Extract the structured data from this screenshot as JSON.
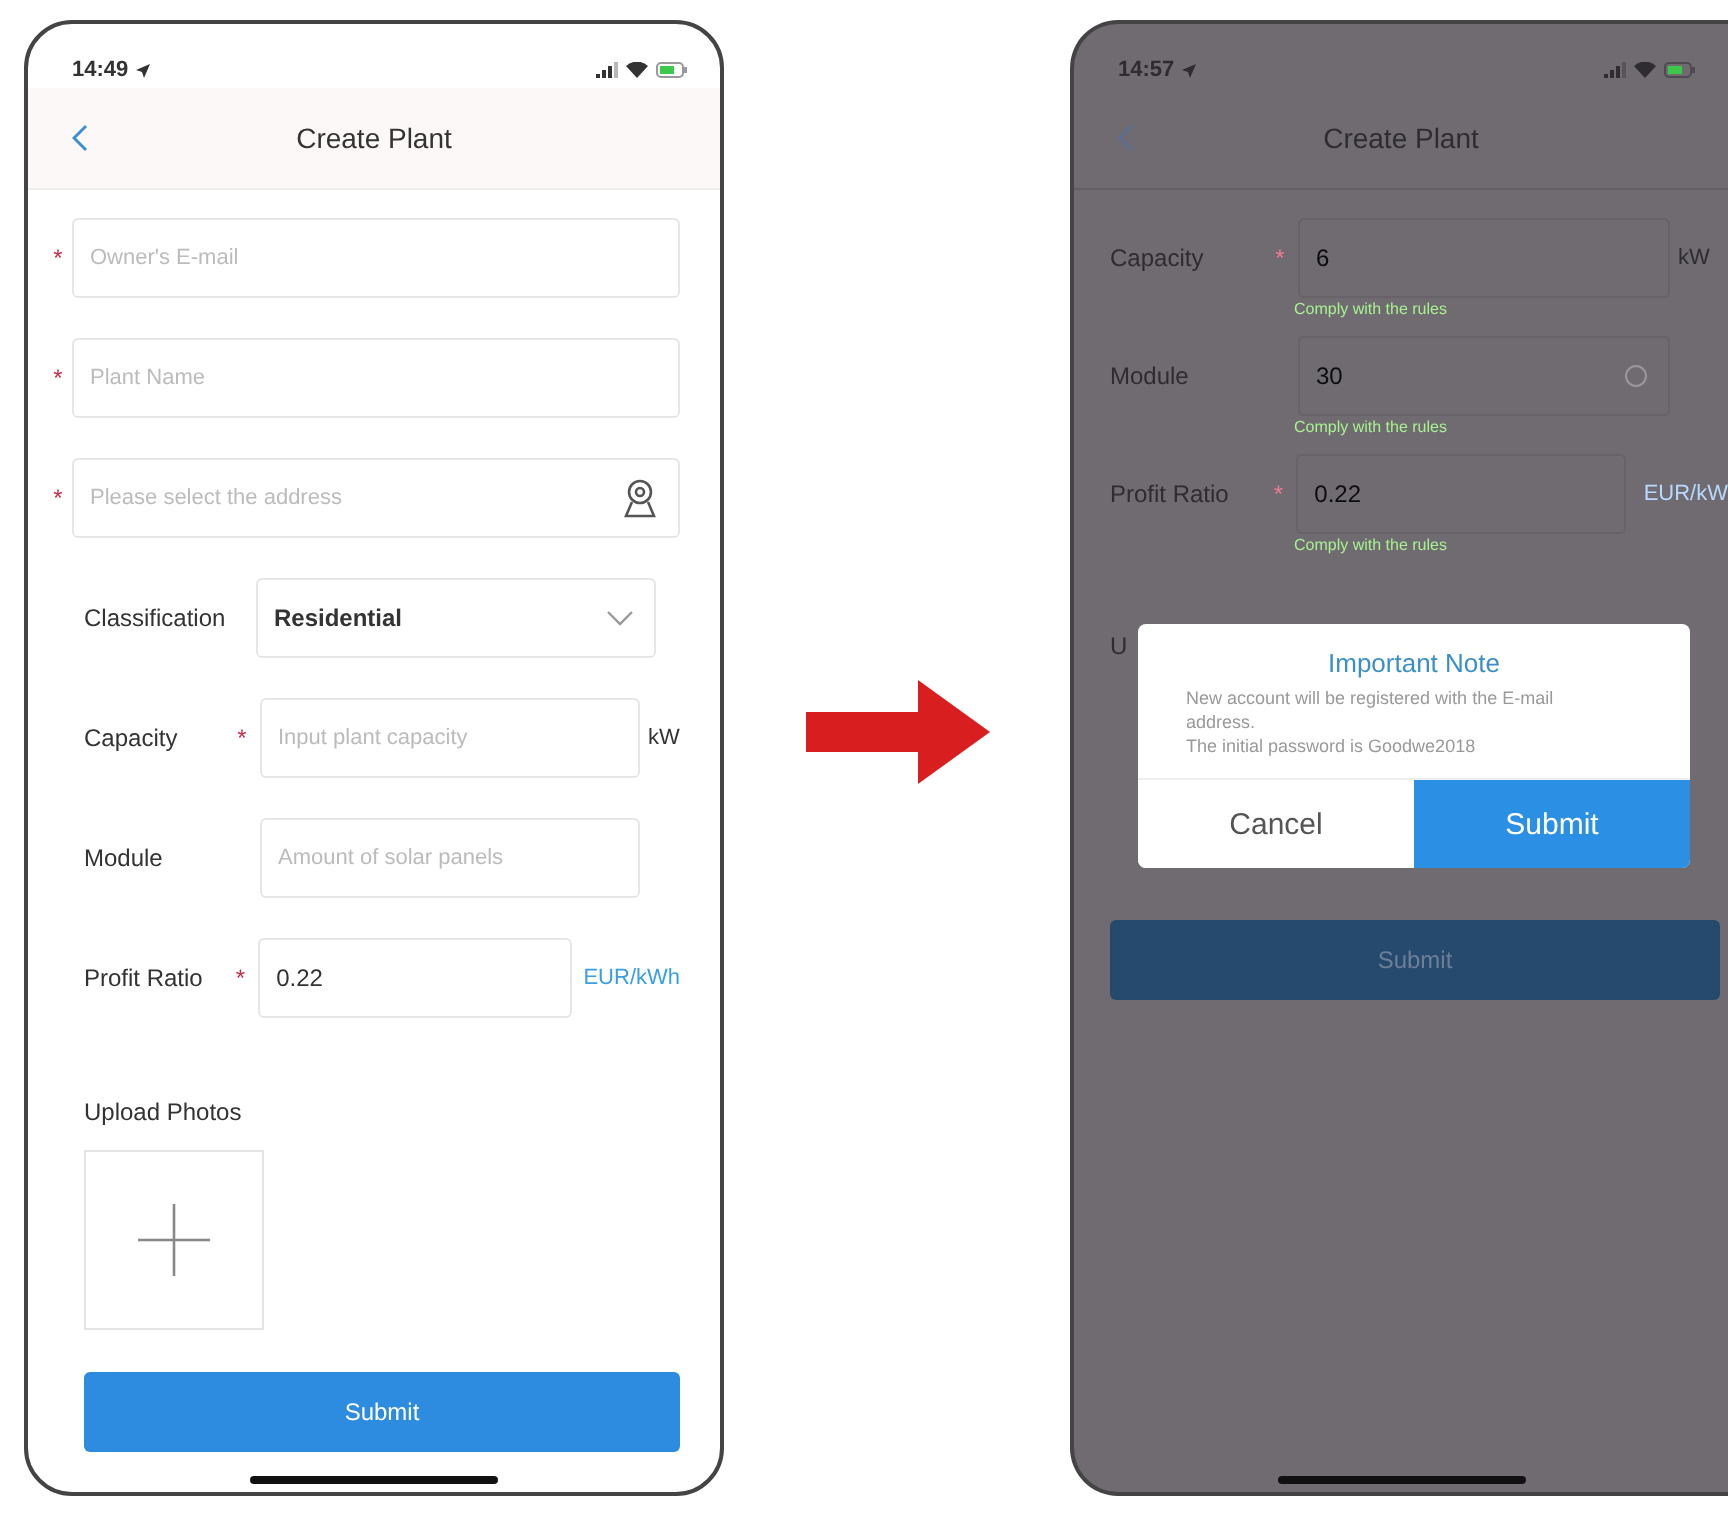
{
  "screens": [
    {
      "kind": "form",
      "status_bar": {
        "time": "14:49"
      },
      "nav": {
        "title": "Create Plant"
      },
      "fields": [
        {
          "kind": "plain",
          "required_mark": "*",
          "placeholder": "Owner's E-mail"
        },
        {
          "kind": "plain",
          "required_mark": "*",
          "placeholder": "Plant Name"
        },
        {
          "kind": "address",
          "required_mark": "*",
          "placeholder": "Please select the address"
        },
        {
          "kind": "select",
          "label": "Classification",
          "value": "Residential"
        },
        {
          "kind": "labeled",
          "required_mark": "*",
          "label": "Capacity",
          "placeholder": "Input plant capacity",
          "unit": "kW",
          "unit_selectable": false
        },
        {
          "kind": "labeled",
          "label": "Module",
          "placeholder": "Amount of solar panels"
        },
        {
          "kind": "labeled",
          "required_mark": "*",
          "label": "Profit Ratio",
          "value": "0.22",
          "unit": "EUR/kWh",
          "unit_selectable": true
        }
      ],
      "upload": {
        "label": "Upload Photos"
      },
      "submit": {
        "label": "Submit"
      }
    },
    {
      "kind": "dialog",
      "status_bar": {
        "time": "14:57"
      },
      "nav": {
        "title": "Create Plant"
      },
      "fields": [
        {
          "kind": "labeled",
          "required_mark": "*",
          "label": "Capacity",
          "value": "6",
          "unit": "kW",
          "unit_selectable": false,
          "hint": "Comply with the rules"
        },
        {
          "kind": "labeled",
          "label": "Module",
          "value": "30",
          "clearable": true,
          "hint": "Comply with the rules"
        },
        {
          "kind": "labeled",
          "required_mark": "*",
          "label": "Profit Ratio",
          "value": "0.22",
          "unit": "EUR/kW",
          "unit_selectable": true,
          "hint": "Comply with the rules"
        }
      ],
      "upload": {
        "label": "U"
      },
      "submit": {
        "label": "Submit"
      },
      "dialog": {
        "title": "Important Note",
        "message": [
          "New account will be registered with the E-mail address.",
          "The initial password is Goodwe2018"
        ],
        "buttons": [
          {
            "label": "Cancel",
            "primary": false
          },
          {
            "label": "Submit",
            "primary": true
          }
        ]
      }
    }
  ]
}
